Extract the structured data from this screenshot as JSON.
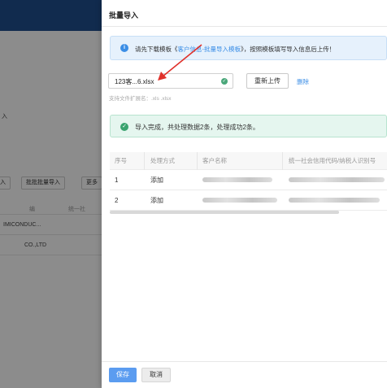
{
  "background": {
    "partial_texts": {
      "a": "入",
      "b": "入",
      "c": "批批批量导入",
      "d": "更多",
      "e": "编",
      "f": "统一社",
      "g": "IMICONDUC...",
      "h": "CO.,LTD"
    }
  },
  "drawer": {
    "title": "批量导入",
    "info_prefix": "请先下载模板《",
    "info_link": "客户信息-批量导入模板",
    "info_suffix": "》，按照模板填写导入信息后上传！",
    "file_name": "123客...6.xlsx",
    "reupload_label": "重新上传",
    "delete_label": "删除",
    "hint": "支持文件扩展名：.xls .xlsx",
    "success_text": "导入完成，共处理数据2条，处理成功2条。",
    "table": {
      "headers": [
        "序号",
        "处理方式",
        "客户名称",
        "统一社会信用代码/纳税人识别号"
      ],
      "rows": [
        {
          "index": "1",
          "method": "添加"
        },
        {
          "index": "2",
          "method": "添加"
        }
      ]
    },
    "save_label": "保存",
    "cancel_label": "取消"
  },
  "colors": {
    "accent": "#3b8ee6",
    "success": "#3aa36f",
    "arrow": "#e0312b"
  }
}
